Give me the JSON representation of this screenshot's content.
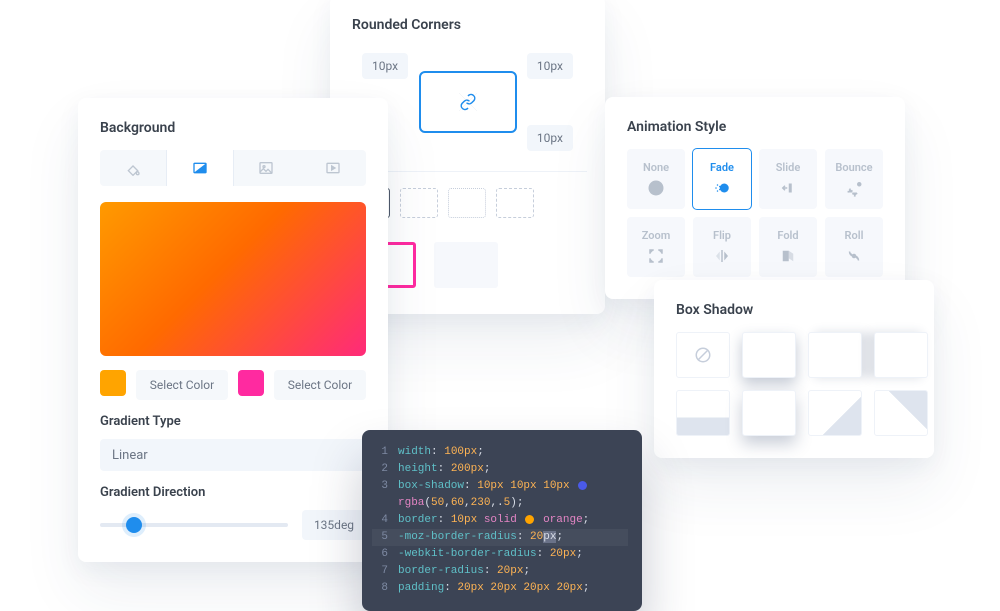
{
  "background": {
    "title": "Background",
    "tabs": [
      "fill",
      "gradient",
      "image",
      "video"
    ],
    "color1_label": "Select Color",
    "color2_label": "Select Color",
    "color1": "#ffa400",
    "color2": "#ff2aa0",
    "gradient_type_label": "Gradient Type",
    "gradient_type_value": "Linear",
    "gradient_direction_label": "Gradient Direction",
    "gradient_direction_value": "135deg"
  },
  "rounded_corners": {
    "title": "Rounded Corners",
    "tl": "10px",
    "tr": "10px",
    "br": "10px"
  },
  "animation": {
    "title": "Animation Style",
    "options": [
      "None",
      "Fade",
      "Slide",
      "Bounce",
      "Zoom",
      "Flip",
      "Fold",
      "Roll"
    ],
    "active": "Fade"
  },
  "box_shadow": {
    "title": "Box Shadow"
  },
  "code": {
    "lines": [
      {
        "n": 1,
        "html": "<span class='c-prop'>width</span><span class='c-white'>: </span><span class='c-num'>100px</span><span class='c-white'>;</span>"
      },
      {
        "n": 2,
        "html": "<span class='c-prop'>height</span><span class='c-white'>: </span><span class='c-num'>200px</span><span class='c-white'>;</span>"
      },
      {
        "n": 3,
        "html": "<span class='c-prop'>box-shadow</span><span class='c-white'>: </span><span class='c-num'>10px 10px 10px</span> <span class='c-col' style='background:#4a5ae8'></span>"
      },
      {
        "n": "",
        "html": "<span class='c-kw'>rgba</span><span class='c-white'>(</span><span class='c-num'>50</span><span class='c-white'>,</span><span class='c-num'>60</span><span class='c-white'>,</span><span class='c-num'>230</span><span class='c-white'>,.</span><span class='c-num'>5</span><span class='c-white'>);</span>"
      },
      {
        "n": 4,
        "html": "<span class='c-prop'>border</span><span class='c-white'>: </span><span class='c-num'>10px</span> <span class='c-kw'>solid</span> <span class='c-col' style='background:#ffa400'></span> <span class='c-kw'>orange</span><span class='c-white'>;</span>"
      },
      {
        "n": 5,
        "hl": true,
        "html": "<span class='c-prop'>-moz-border-radius</span><span class='c-white'>: </span><span class='c-num'>20</span><span class='c-white' style='background:#6a7288'>px</span><span class='c-white'>;</span>"
      },
      {
        "n": 6,
        "html": "<span class='c-prop'>-webkit-border-radius</span><span class='c-white'>: </span><span class='c-num'>20px</span><span class='c-white'>;</span>"
      },
      {
        "n": 7,
        "html": "<span class='c-prop'>border-radius</span><span class='c-white'>: </span><span class='c-num'>20px</span><span class='c-white'>;</span>"
      },
      {
        "n": 8,
        "html": "<span class='c-prop'>padding</span><span class='c-white'>: </span><span class='c-num'>20px 20px 20px 20px</span><span class='c-white'>;</span>"
      }
    ]
  }
}
